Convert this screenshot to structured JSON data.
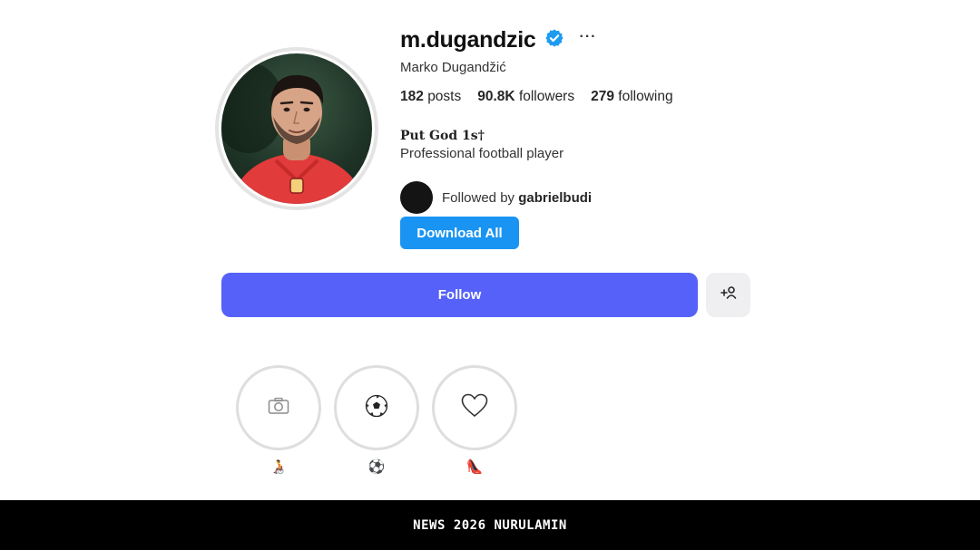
{
  "profile": {
    "username": "m.dugandzic",
    "full_name": "Marko Dugandžić",
    "verified_icon": "verified-badge-icon",
    "verified_color": "#1d9bf0",
    "more_label": "···"
  },
  "stats": {
    "posts_count": "182",
    "posts_label": "posts",
    "followers_count": "90.8K",
    "followers_label": "followers",
    "following_count": "279",
    "following_label": "following"
  },
  "bio": {
    "title": "Put God 1s†",
    "text": "Professional football player"
  },
  "followed_by": {
    "prefix": "Followed by",
    "user": "gabrielbudi"
  },
  "buttons": {
    "download_all": "Download All",
    "download_color": "#1a94f2",
    "follow": "Follow",
    "follow_color": "#5561f9",
    "add_user_icon": "add-user-icon"
  },
  "highlights": [
    {
      "cover_icon": "camera-icon",
      "label": "🧑‍🦽"
    },
    {
      "cover_icon": "soccer-ball-icon",
      "label": "⚽"
    },
    {
      "cover_icon": "heart-icon",
      "label": "👠"
    }
  ],
  "footer": {
    "text": "NEWS 2026 NURULAMIN"
  }
}
